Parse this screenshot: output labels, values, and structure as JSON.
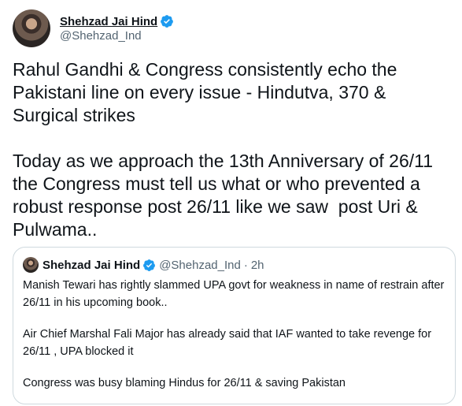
{
  "author": {
    "display_name": "Shehzad Jai Hind",
    "handle": "@Shehzad_Ind"
  },
  "tweet": {
    "text": "Rahul Gandhi & Congress consistently echo the Pakistani line on every issue - Hindutva, 370 & Surgical strikes\n\nToday as we approach the 13th Anniversary of 26/11 the Congress must tell us what or who prevented a robust response post 26/11 like we saw  post Uri & Pulwama.."
  },
  "quoted_tweet": {
    "display_name": "Shehzad Jai Hind",
    "handle": "@Shehzad_Ind",
    "separator": "·",
    "time": "2h",
    "paragraphs": [
      "Manish Tewari has rightly slammed UPA govt for weakness in name of restrain after 26/11 in his upcoming book..",
      "Air Chief Marshal Fali Major has already said that IAF wanted to take revenge for 26/11 , UPA blocked it",
      "Congress was busy blaming Hindus for 26/11 & saving Pakistan"
    ]
  },
  "icons": {
    "verified": "verified-badge-icon",
    "avatar": "avatar"
  },
  "colors": {
    "verified_blue": "#1d9bf0",
    "text_primary": "#0f1419",
    "text_secondary": "#536471",
    "border": "#cfd9de"
  }
}
